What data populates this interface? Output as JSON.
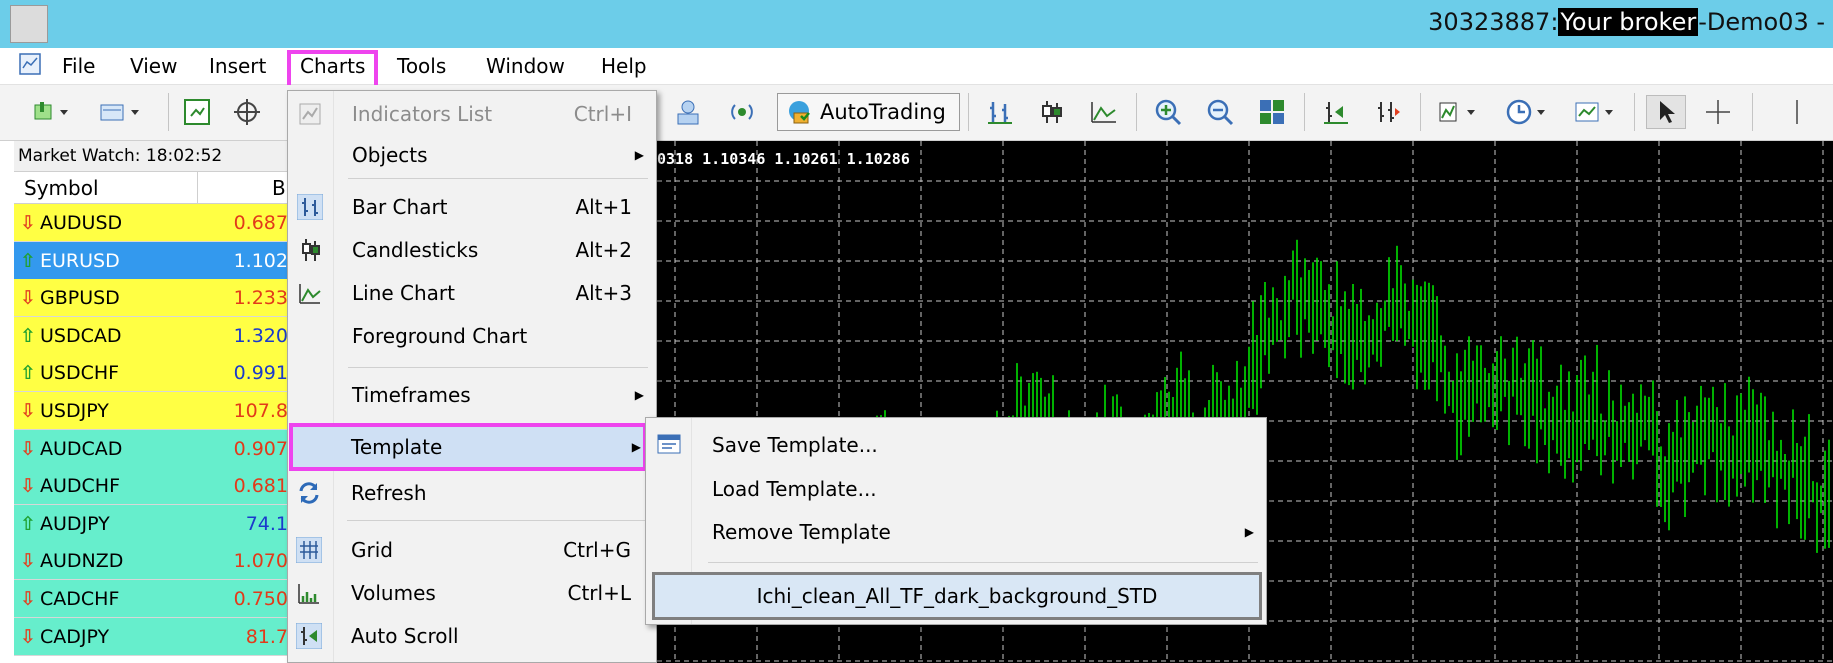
{
  "window": {
    "account": "30323887:",
    "broker": "Your broker",
    "server": "-Demo03 -"
  },
  "menubar": {
    "items": [
      "File",
      "View",
      "Insert",
      "Charts",
      "Tools",
      "Window",
      "Help"
    ]
  },
  "toolbar": {
    "autotrading_label": "AutoTrading"
  },
  "market_watch": {
    "header": "Market Watch: 18:02:52",
    "columns": [
      "Symbol",
      "B"
    ],
    "rows": [
      {
        "symbol": "AUDUSD",
        "bid": "0.687",
        "dir": "down",
        "bg": "#ffff44",
        "bid_color": "#e23a1a"
      },
      {
        "symbol": "EURUSD",
        "bid": "1.102",
        "dir": "up",
        "bg": "#3399ee",
        "bid_color": "#ffffff"
      },
      {
        "symbol": "GBPUSD",
        "bid": "1.233",
        "dir": "down",
        "bg": "#ffff44",
        "bid_color": "#e23a1a"
      },
      {
        "symbol": "USDCAD",
        "bid": "1.320",
        "dir": "up",
        "bg": "#ffff44",
        "bid_color": "#1a3acc"
      },
      {
        "symbol": "USDCHF",
        "bid": "0.991",
        "dir": "up",
        "bg": "#ffff44",
        "bid_color": "#1a3acc"
      },
      {
        "symbol": "USDJPY",
        "bid": "107.8",
        "dir": "down",
        "bg": "#ffff44",
        "bid_color": "#e23a1a"
      },
      {
        "symbol": "AUDCAD",
        "bid": "0.907",
        "dir": "down",
        "bg": "#66eecc",
        "bid_color": "#e23a1a"
      },
      {
        "symbol": "AUDCHF",
        "bid": "0.681",
        "dir": "down",
        "bg": "#66eecc",
        "bid_color": "#e23a1a"
      },
      {
        "symbol": "AUDJPY",
        "bid": "74.1",
        "dir": "up",
        "bg": "#66eecc",
        "bid_color": "#1a3acc"
      },
      {
        "symbol": "AUDNZD",
        "bid": "1.070",
        "dir": "down",
        "bg": "#66eecc",
        "bid_color": "#e23a1a"
      },
      {
        "symbol": "CADCHF",
        "bid": "0.750",
        "dir": "down",
        "bg": "#66eecc",
        "bid_color": "#e23a1a"
      },
      {
        "symbol": "CADJPY",
        "bid": "81.7",
        "dir": "down",
        "bg": "#66eecc",
        "bid_color": "#e23a1a"
      }
    ]
  },
  "chart": {
    "info": "0318 1.10346 1.10261 1.10286"
  },
  "charts_menu": {
    "indicators_list": "Indicators List",
    "indicators_shortcut": "Ctrl+I",
    "objects": "Objects",
    "bar_chart": "Bar Chart",
    "bar_chart_shortcut": "Alt+1",
    "candlesticks": "Candlesticks",
    "candlesticks_shortcut": "Alt+2",
    "line_chart": "Line Chart",
    "line_chart_shortcut": "Alt+3",
    "foreground_chart": "Foreground Chart",
    "timeframes": "Timeframes",
    "template": "Template",
    "refresh": "Refresh",
    "grid": "Grid",
    "grid_shortcut": "Ctrl+G",
    "volumes": "Volumes",
    "volumes_shortcut": "Ctrl+L",
    "auto_scroll": "Auto Scroll"
  },
  "template_menu": {
    "save": "Save Template...",
    "load": "Load Template...",
    "remove": "Remove Template",
    "item": "Ichi_clean_All_TF_dark_background_STD"
  },
  "colors": {
    "title_bar": "#6ccde9",
    "highlight": "#ee44ee",
    "chart_bg": "#000000",
    "candle": "#00ee00"
  }
}
